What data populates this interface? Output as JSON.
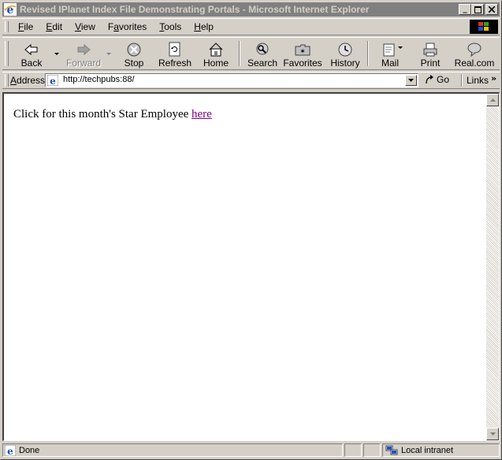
{
  "window": {
    "title": "Revised IPlanet Index File Demonstrating Portals - Microsoft Internet Explorer",
    "minimize": "_",
    "maximize": "□",
    "close": "×"
  },
  "menu": [
    {
      "u": "F",
      "rest": "ile"
    },
    {
      "u": "E",
      "rest": "dit"
    },
    {
      "u": "V",
      "rest": "iew"
    },
    {
      "pre": "F",
      "u": "a",
      "rest": "vorites"
    },
    {
      "u": "T",
      "rest": "ools"
    },
    {
      "u": "H",
      "rest": "elp"
    }
  ],
  "toolbar": {
    "back": "Back",
    "forward": "Forward",
    "stop": "Stop",
    "refresh": "Refresh",
    "home": "Home",
    "search": "Search",
    "favorites": "Favorites",
    "history": "History",
    "mail": "Mail",
    "print": "Print",
    "real": "Real.com"
  },
  "address": {
    "label_u": "A",
    "label_rest": "ddress",
    "url": "http://techpubs:88/",
    "go": "Go",
    "links": "Links",
    "chevron": "»"
  },
  "page": {
    "text": "Click for this month's Star Employee ",
    "link": "here"
  },
  "status": {
    "text": "Done",
    "zone": "Local intranet"
  },
  "colors": {
    "link_visited": "#800080",
    "chrome": "#d4d0c8",
    "inactive_title": "#808080"
  }
}
